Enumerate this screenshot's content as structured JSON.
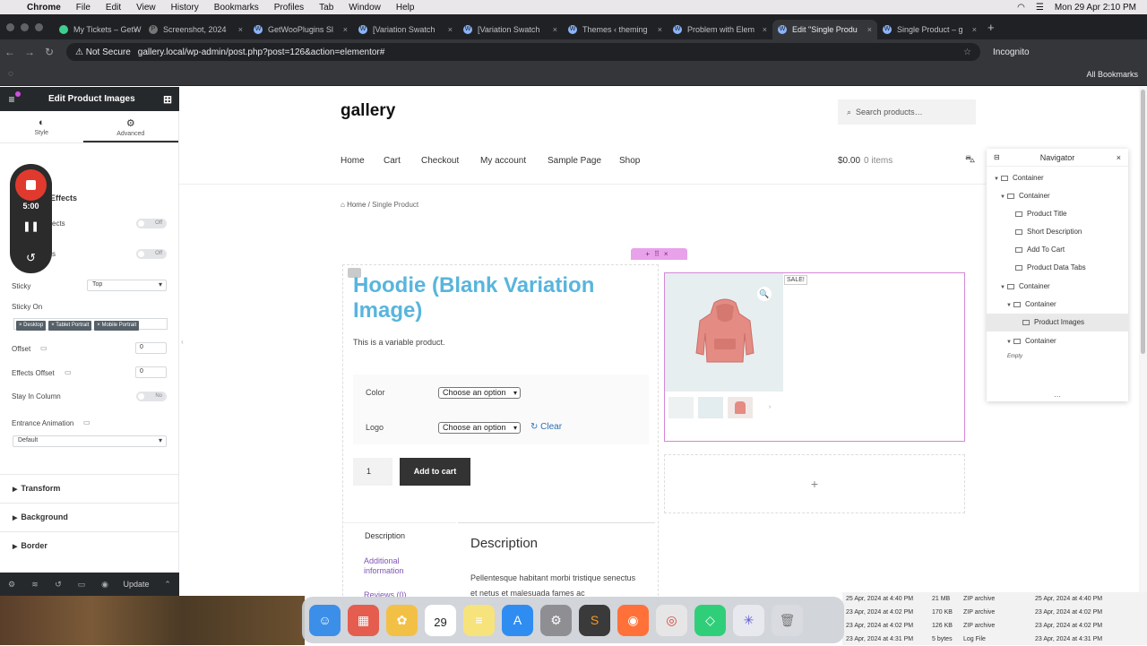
{
  "menubar": {
    "items": [
      "Chrome",
      "File",
      "Edit",
      "View",
      "History",
      "Bookmarks",
      "Profiles",
      "Tab",
      "Window",
      "Help"
    ],
    "datetime": "Mon 29 Apr  2:10 PM"
  },
  "tabs": [
    {
      "title": "My Tickets – GetW",
      "active": false
    },
    {
      "title": "Screenshot, 2024",
      "active": false
    },
    {
      "title": "GetWooPlugins Sl",
      "active": false
    },
    {
      "title": "[Variation Swatch",
      "active": false
    },
    {
      "title": "[Variation Swatch",
      "active": false
    },
    {
      "title": "Themes ‹ theming",
      "active": false
    },
    {
      "title": "Problem with Elem",
      "active": false
    },
    {
      "title": "Edit \"Single Produ",
      "active": true
    },
    {
      "title": "Single Product – g",
      "active": false
    }
  ],
  "address": {
    "security": "Not Secure",
    "url": "gallery.local/wp-admin/post.php?post=126&action=elementor#",
    "incognito": "Incognito"
  },
  "bookmarks": {
    "all": "All Bookmarks"
  },
  "panel": {
    "title": "Edit Product Images",
    "tabs": [
      {
        "label": "Style",
        "icon": "◐"
      },
      {
        "label": "Advanced",
        "icon": "⚙"
      }
    ],
    "section_effects": "Effects",
    "effects_partial1": "ects",
    "effects_partial2": "s",
    "off": "Off",
    "sticky_label": "Sticky",
    "sticky_value": "Top",
    "sticky_on_label": "Sticky On",
    "sticky_on_chips": [
      "× Desktop",
      "× Tablet Portrait",
      "× Mobile Portrait"
    ],
    "offset_label": "Offset",
    "offset_value": "0",
    "effects_offset_label": "Effects Offset",
    "effects_offset_value": "0",
    "stay_label": "Stay In Column",
    "no": "No",
    "entrance_label": "Entrance Animation",
    "entrance_value": "Default",
    "sections": [
      "Transform",
      "Background",
      "Border"
    ],
    "update": "Update"
  },
  "recorder": {
    "time": "5:00"
  },
  "site": {
    "title": "gallery",
    "search_placeholder": "Search products…",
    "nav": [
      "Home",
      "Cart",
      "Checkout",
      "My account",
      "Sample Page",
      "Shop"
    ],
    "cart_total": "$0.00",
    "cart_items": "0 items",
    "breadcrumb_home": "Home",
    "breadcrumb_current": "Single Product"
  },
  "product": {
    "title": "Hoodie (Blank Variation Image)",
    "short": "This is a variable product.",
    "color_label": "Color",
    "logo_label": "Logo",
    "choose": "Choose an option",
    "clear": "Clear",
    "qty": "1",
    "add_to_cart": "Add to cart",
    "tab_description": "Description",
    "tab_additional": "Additional information",
    "tab_reviews": "Reviews (0)",
    "desc_heading": "Description",
    "desc_text": "Pellentesque habitant morbi tristique senectus et netus et malesuada fames ac",
    "sale": "SALE!"
  },
  "navigator": {
    "title": "Navigator",
    "rows": [
      "Container",
      "Container",
      "Product Title",
      "Short Description",
      "Add To Cart",
      "Product Data Tabs",
      "Container",
      "Container",
      "Product Images",
      "Container"
    ],
    "empty": "Empty"
  },
  "finder": {
    "rows": [
      {
        "date": "25 Apr, 2024 at 4:40 PM",
        "size": "21 MB",
        "kind": "ZIP archive",
        "date2": "25 Apr, 2024 at 4:40 PM"
      },
      {
        "date": "23 Apr, 2024 at 4:02 PM",
        "size": "170 KB",
        "kind": "ZIP archive",
        "date2": "23 Apr, 2024 at 4:02 PM"
      },
      {
        "date": "23 Apr, 2024 at 4:02 PM",
        "size": "126 KB",
        "kind": "ZIP archive",
        "date2": "23 Apr, 2024 at 4:02 PM"
      },
      {
        "date": "23 Apr, 2024 at 4:31 PM",
        "size": "5 bytes",
        "kind": "Log File",
        "date2": "23 Apr, 2024 at 4:31 PM"
      }
    ]
  },
  "dock": {
    "calendar_day": "29"
  }
}
